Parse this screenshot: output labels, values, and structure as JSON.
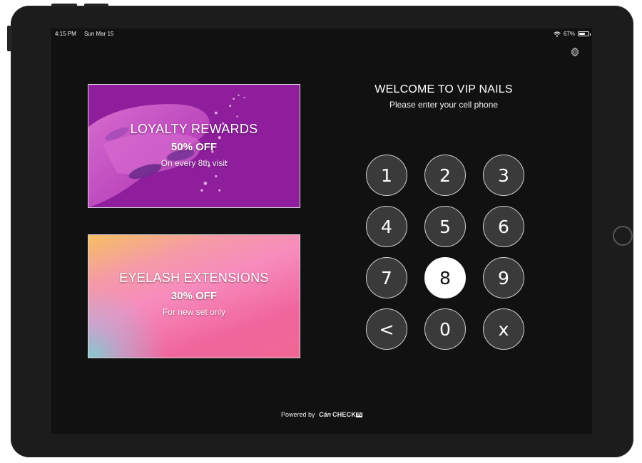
{
  "status_bar": {
    "time": "4:15 PM",
    "date": "Sun Mar 15",
    "battery": "67%",
    "battery_level": 0.67
  },
  "icons": {
    "settings": "gear-icon",
    "wifi": "wifi-icon",
    "battery": "battery-icon"
  },
  "promos": [
    {
      "title": "LOYALTY REWARDS",
      "discount": "50% OFF",
      "note": "On every 8th visit",
      "color": "#8e1e9c"
    },
    {
      "title": "EYELASH EXTENSIONS",
      "discount": "30% OFF",
      "note": "For new set only",
      "color": "#f06795"
    }
  ],
  "welcome": {
    "title": "WELCOME TO VIP NAILS",
    "subtitle": "Please enter your cell phone"
  },
  "keypad": {
    "keys": [
      "1",
      "2",
      "3",
      "4",
      "5",
      "6",
      "7",
      "8",
      "9",
      "<",
      "0",
      "x"
    ],
    "highlighted_key": "8"
  },
  "footer": {
    "powered_by": "Powered by",
    "brand_can": "Cán",
    "brand_check": "CHECK",
    "brand_in": "IN"
  }
}
